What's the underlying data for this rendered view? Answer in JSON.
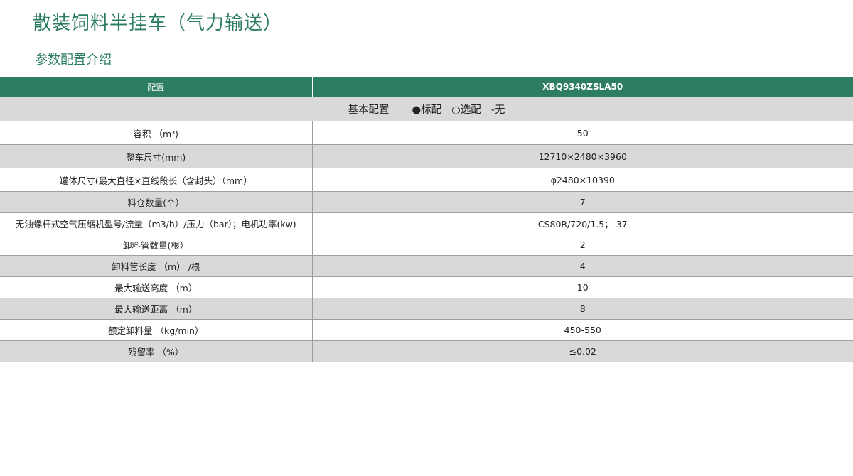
{
  "header": {
    "title": "散装饲料半挂车（气力输送）",
    "subtitle": "参数配置介绍"
  },
  "table": {
    "col_config": "配置",
    "col_model": "XBQ9340ZSLA50",
    "group": {
      "label": "基本配置",
      "legend_standard": "●标配",
      "legend_optional": "○选配",
      "legend_none": "-无"
    },
    "rows": [
      {
        "key": "容积 （m³)",
        "value": "50"
      },
      {
        "key": "整车尺寸(mm)",
        "value": "12710×2480×3960"
      },
      {
        "key": "罐体尺寸(最大直径×直线段长（含封头）（mm）",
        "value": "φ2480×10390"
      },
      {
        "key": "料仓数量(个）",
        "value": "7"
      },
      {
        "key": "无油螺杆式空气压缩机型号/流量（m3/h）/压力（bar）；电机功率(kw)",
        "value": "CS80R/720/1.5； 37"
      },
      {
        "key": "卸料管数量(根）",
        "value": "2"
      },
      {
        "key": "卸料管长度 （m） /根",
        "value": "4"
      },
      {
        "key": "最大输送高度 （m）",
        "value": "10"
      },
      {
        "key": "最大输送距离 （m）",
        "value": "8"
      },
      {
        "key": "额定卸料量 （kg/min）",
        "value": "450-550"
      },
      {
        "key": "残留率 （%）",
        "value": "≤0.02"
      }
    ]
  }
}
